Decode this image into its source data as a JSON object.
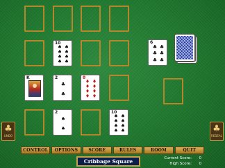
{
  "game": {
    "title": "Cribbage Square",
    "current_score_label": "Current Score:",
    "current_score": "0",
    "high_score_label": "High Score:",
    "high_score": "0"
  },
  "menu": {
    "items": [
      "CONTROL",
      "OPTIONS",
      "SCORE",
      "RULES",
      "ROOM",
      "QUIT"
    ]
  },
  "side_buttons": {
    "left": {
      "label": "UNDO",
      "icon": "spade-icon"
    },
    "right": {
      "label": "REDEAL",
      "icon": "spade-icon"
    }
  },
  "cards": {
    "next_card": {
      "rank": "6",
      "suit": "♣",
      "color": "black"
    },
    "r1c1": {
      "rank": "10",
      "suit": "♠",
      "color": "black"
    },
    "r2c0": {
      "rank": "K",
      "suit": "♣",
      "color": "black"
    },
    "r2c1": {
      "rank": "2",
      "suit": "♣",
      "color": "black"
    },
    "r2c2": {
      "rank": "8",
      "suit": "♦",
      "color": "red"
    },
    "r3c1": {
      "rank": "2",
      "suit": "♠",
      "color": "black"
    },
    "r3c3": {
      "rank": "10",
      "suit": "♠",
      "color": "black"
    }
  },
  "colors": {
    "felt": "#217a30",
    "slot_border": "#b8862a",
    "menu_gold": "#d9b15a",
    "plaque_blue": "#0b1f4a",
    "deck_blue": "#2038a8"
  }
}
